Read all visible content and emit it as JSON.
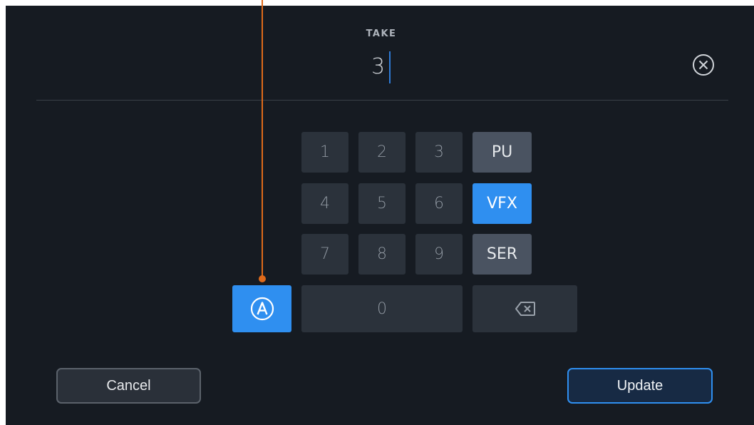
{
  "field": {
    "label": "TAKE",
    "value": "3"
  },
  "keypad": {
    "digits": [
      "1",
      "2",
      "3",
      "4",
      "5",
      "6",
      "7",
      "8",
      "9",
      "0"
    ],
    "tags": [
      {
        "label": "PU",
        "active": false
      },
      {
        "label": "VFX",
        "active": true
      },
      {
        "label": "SER",
        "active": false
      }
    ],
    "alpha_toggle_icon": "circled-a-icon",
    "backspace_icon": "backspace-icon"
  },
  "actions": {
    "cancel_label": "Cancel",
    "update_label": "Update"
  },
  "icons": {
    "clear": "clear-circle-x-icon"
  },
  "colors": {
    "background": "#161b22",
    "key": "#2b323b",
    "tag_key": "#4a5361",
    "accent": "#2f8ff0",
    "annotation": "#e06a1a"
  }
}
